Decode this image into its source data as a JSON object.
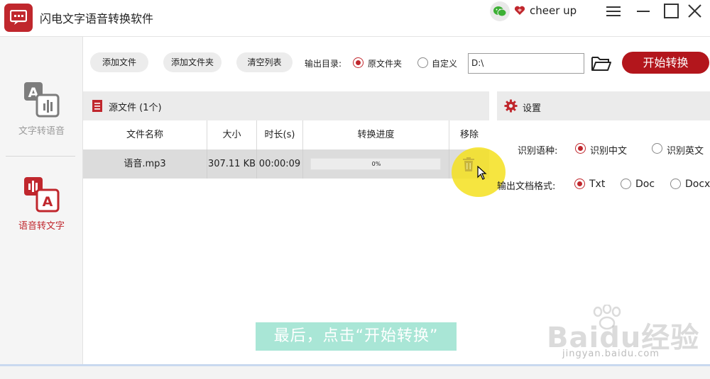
{
  "app": {
    "title": "闪电文字语音转换软件",
    "username": "cheer up",
    "accent_color": "#c0272d"
  },
  "window_controls": [
    "menu-icon",
    "minimize-icon",
    "maximize-icon",
    "close-icon"
  ],
  "sidebar": {
    "items": [
      {
        "label": "文字转语音",
        "icon": "text-to-speech-icon",
        "active": false
      },
      {
        "label": "语音转文字",
        "icon": "speech-to-text-icon",
        "active": true
      }
    ]
  },
  "toolbar": {
    "add_file": "添加文件",
    "add_folder": "添加文件夹",
    "clear_list": "清空列表",
    "output_dir_label": "输出目录:",
    "output_options": [
      {
        "label": "原文件夹",
        "selected": true
      },
      {
        "label": "自定义",
        "selected": false
      }
    ],
    "path_value": "D:\\",
    "start_button": "开始转换"
  },
  "source": {
    "title": "源文件 (1个)",
    "columns": [
      "文件名称",
      "大小",
      "时长(s)",
      "转换进度",
      "移除"
    ],
    "rows": [
      {
        "name": "语音.mp3",
        "size": "307.11 KB",
        "duration": "00:00:09",
        "progress": "0%",
        "progress_value": 0
      }
    ]
  },
  "settings": {
    "title": "设置",
    "language_label": "识别语种:",
    "language_options": [
      {
        "label": "识别中文",
        "selected": true
      },
      {
        "label": "识别英文",
        "selected": false
      }
    ],
    "format_label": "输出文档格式:",
    "format_options": [
      {
        "label": "Txt",
        "selected": true
      },
      {
        "label": "Doc",
        "selected": false
      },
      {
        "label": "Docx",
        "selected": false
      }
    ]
  },
  "overlay": {
    "subtitle": "最后，点击“开始转换”",
    "watermark_brand": "Baidu经验",
    "watermark_url": "jingyan.baidu.com"
  }
}
